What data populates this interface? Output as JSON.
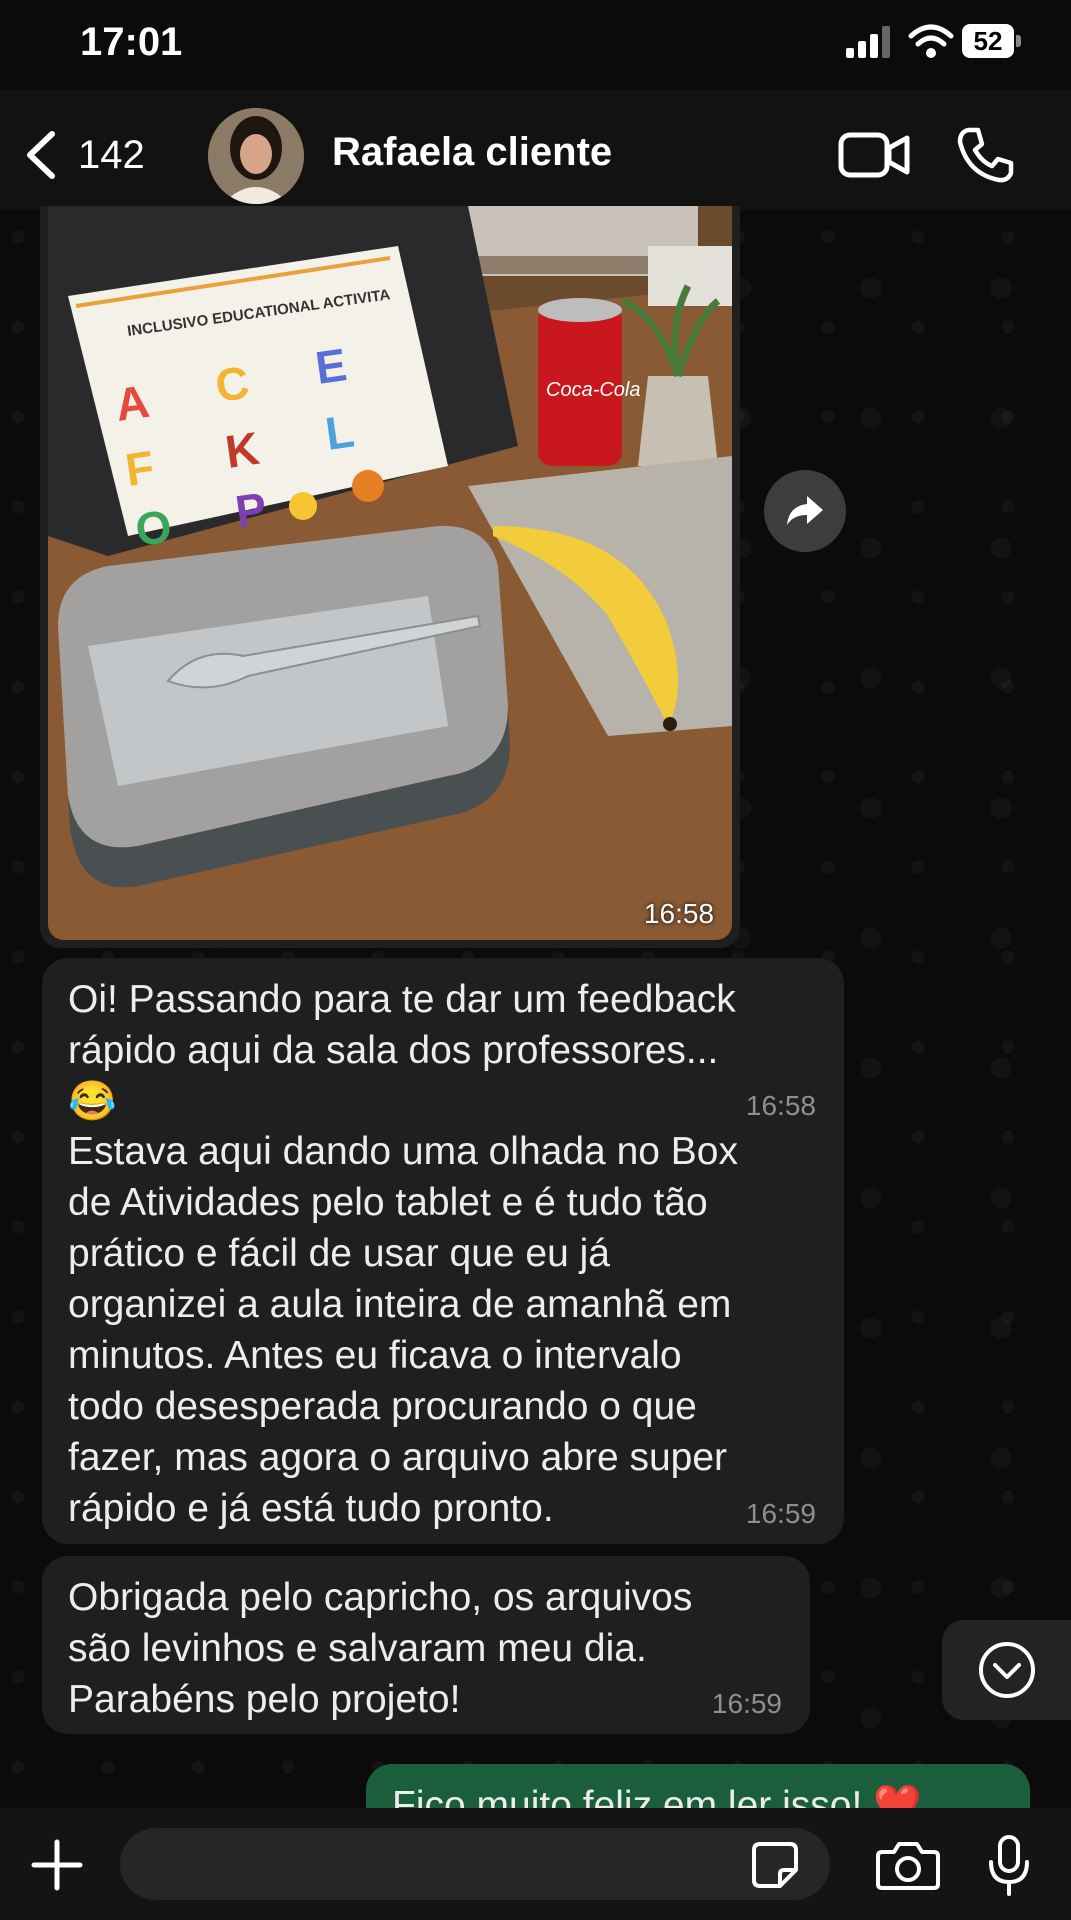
{
  "status_bar": {
    "time": "17:01",
    "battery": "52"
  },
  "header": {
    "back_count": "142",
    "contact_name": "Rafaela cliente"
  },
  "image_message": {
    "time": "16:58",
    "worksheet_title": "INCLUSIVO EDUCATIONAL ACTIVITA",
    "letters": [
      "A",
      "C",
      "E",
      "F",
      "K",
      "L",
      "O",
      "P"
    ],
    "can_text": "Coca-Cola"
  },
  "messages": [
    {
      "direction": "incoming",
      "part1": "Oi! Passando para te dar um feedback\nrápido aqui da sala dos professores...\n😂",
      "time1": "16:58",
      "part2": "Estava aqui dando uma olhada no Box\nde Atividades pelo tablet e é tudo tão\nprático e fácil de usar que eu já\norganizei a aula inteira de amanhã em\nminutos. Antes eu ficava o intervalo\ntodo desesperada procurando o que\nfazer, mas agora o arquivo abre super\nrápido e já está tudo pronto.",
      "time2": "16:59"
    },
    {
      "direction": "incoming",
      "text": "Obrigada pelo capricho, os arquivos\nsão levinhos e salvaram meu dia.\nParabéns pelo projeto!",
      "time": "16:59"
    },
    {
      "direction": "outgoing",
      "text": "Fico muito feliz em ler isso! ❤️"
    }
  ],
  "input": {
    "placeholder": ""
  },
  "icons": [
    "back-icon",
    "video-call-icon",
    "phone-icon",
    "forward-icon",
    "chevron-down-icon",
    "plus-icon",
    "sticker-icon",
    "camera-icon",
    "microphone-icon"
  ],
  "colors": {
    "background": "#0b0b0b",
    "incoming_bubble": "#1f1f1f",
    "outgoing_bubble": "#1b5e3b"
  }
}
